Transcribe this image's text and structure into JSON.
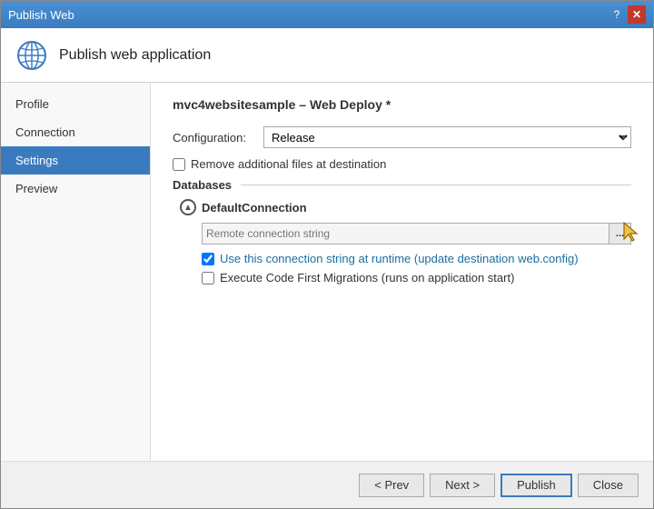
{
  "titleBar": {
    "title": "Publish Web",
    "helpBtn": "?",
    "closeBtn": "✕"
  },
  "header": {
    "icon": "globe",
    "title": "Publish web application"
  },
  "sidebar": {
    "items": [
      {
        "id": "profile",
        "label": "Profile",
        "active": false
      },
      {
        "id": "connection",
        "label": "Connection",
        "active": false
      },
      {
        "id": "settings",
        "label": "Settings",
        "active": true
      },
      {
        "id": "preview",
        "label": "Preview",
        "active": false
      }
    ]
  },
  "main": {
    "sectionTitle": "mvc4websitesample",
    "deployMethod": "Web Deploy *",
    "configuration": {
      "label": "Configuration:",
      "value": "Release"
    },
    "removeFilesCheckbox": {
      "checked": false,
      "label": "Remove additional files at destination"
    },
    "databases": {
      "title": "Databases",
      "defaultConnection": {
        "name": "DefaultConnection",
        "connectionStringPlaceholder": "Remote connection string",
        "ellipsisBtn": "...",
        "useConnectionStringCheckbox": {
          "checked": true,
          "label": "Use this connection string at runtime (update destination web.config)"
        },
        "codeFirstMigrationsCheckbox": {
          "checked": false,
          "label": "Execute Code First Migrations (runs on application start)"
        }
      }
    }
  },
  "footer": {
    "prevBtn": "< Prev",
    "nextBtn": "Next >",
    "publishBtn": "Publish",
    "closeBtn": "Close"
  }
}
